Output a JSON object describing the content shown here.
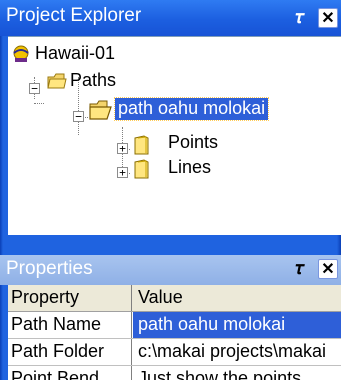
{
  "explorer": {
    "title": "Project Explorer",
    "pin_icon": "pin-icon",
    "close_icon": "close-icon",
    "tree": {
      "root": {
        "label": "Hawaii-01",
        "icon": "project-icon"
      },
      "paths": {
        "label": "Paths",
        "icon": "folder-icon",
        "expanded": true
      },
      "path": {
        "label": "path oahu molokai",
        "icon": "open-folder-icon",
        "selected": true,
        "expanded": true
      },
      "points": {
        "label": "Points",
        "icon": "folder-icon",
        "expanded": false
      },
      "lines": {
        "label": "Lines",
        "icon": "folder-icon",
        "expanded": false
      }
    }
  },
  "properties": {
    "title": "Properties",
    "columns": {
      "property": "Property",
      "value": "Value"
    },
    "rows": [
      {
        "name": "Path Name",
        "value": "path oahu molokai"
      },
      {
        "name": "Path Folder",
        "value": "c:\\makai projects\\makai"
      },
      {
        "name": "Point Bend",
        "value": "Just show the points"
      }
    ]
  },
  "colors": {
    "titlebar": "#1c5fe0",
    "selection": "#2e5fd8",
    "inactive_titlebar": "#a8c4ef"
  }
}
